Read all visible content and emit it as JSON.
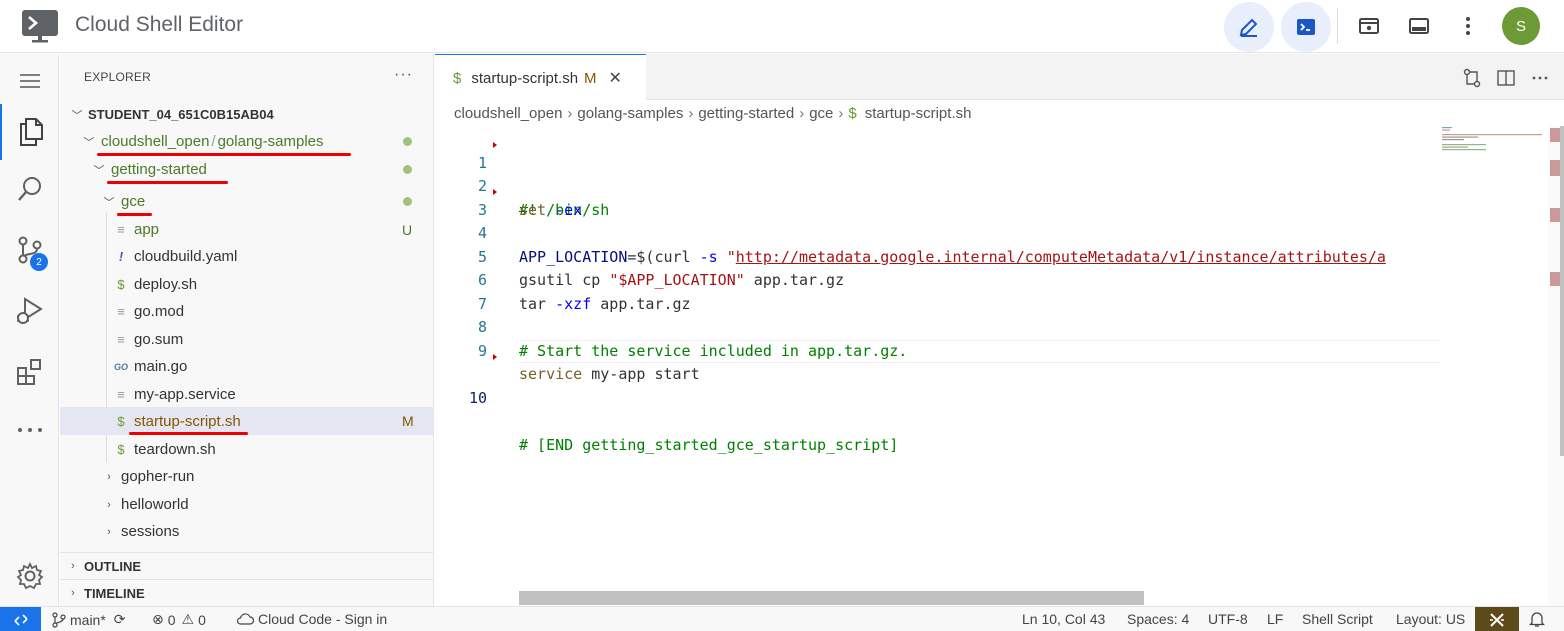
{
  "app": {
    "title": "Cloud Shell Editor",
    "avatar_initial": "S",
    "accent": "#1a73e8"
  },
  "activity": {
    "scm_badge": "2"
  },
  "explorer": {
    "header": "EXPLORER",
    "more": "···",
    "workspace": "STUDENT_04_651C0B15AB04",
    "rows": [
      {
        "label_a": "cloudshell_open",
        "sep": "/",
        "label_b": "golang-samples",
        "status": "dot"
      },
      {
        "label": "getting-started",
        "status": "dot"
      },
      {
        "label": "gce",
        "status": "dot"
      },
      {
        "label": "app",
        "icon": "lines-icon",
        "git": "U"
      },
      {
        "label": "cloudbuild.yaml",
        "icon": "yaml-icon",
        "glyph": "!"
      },
      {
        "label": "deploy.sh",
        "icon": "shell-icon",
        "glyph": "$"
      },
      {
        "label": "go.mod",
        "icon": "lines-icon"
      },
      {
        "label": "go.sum",
        "icon": "lines-icon"
      },
      {
        "label": "main.go",
        "icon": "go-icon",
        "glyph": "GO"
      },
      {
        "label": "my-app.service",
        "icon": "lines-icon"
      },
      {
        "label": "startup-script.sh",
        "icon": "shell-icon",
        "glyph": "$",
        "git": "M"
      },
      {
        "label": "teardown.sh",
        "icon": "shell-icon",
        "glyph": "$"
      },
      {
        "label": "gopher-run"
      },
      {
        "label": "helloworld"
      },
      {
        "label": "sessions"
      }
    ],
    "outline": "OUTLINE",
    "timeline": "TIMELINE"
  },
  "editor": {
    "tab": {
      "label": "startup-script.sh",
      "modified": "M",
      "close": "✕"
    },
    "breadcrumb": [
      "cloudshell_open",
      "golang-samples",
      "getting-started",
      "gce",
      "startup-script.sh"
    ],
    "breadcrumb_sep": "›",
    "line_numbers": [
      "1",
      "2",
      "3",
      "4",
      "5",
      "6",
      "7",
      "8",
      "9",
      "10"
    ],
    "code": {
      "l1": "#! /bin/sh",
      "l2_cmd": "set",
      "l2_flag": " -ex",
      "l4_var": "APP_LOCATION",
      "l4_eq": "=$(curl",
      "l4_flag": " -s ",
      "l4_q": "\"",
      "l4_url": "http://metadata.google.internal/computeMetadata/v1/instance/attributes/a",
      "l5_cmd": "gsutil cp ",
      "l5_str": "\"$APP_LOCATION\"",
      "l5_rest": " app.tar.gz",
      "l6_cmd": "tar",
      "l6_flag": " -xzf",
      "l6_rest": " app.tar.gz",
      "l8": "# Start the service included in app.tar.gz.",
      "l9_cmd": "service",
      "l9_rest": " my-app start",
      "l10": "# [END getting_started_gce_startup_script]"
    }
  },
  "status": {
    "branch": "main*",
    "errors": "0",
    "warnings": "0",
    "cloud_code": "Cloud Code - Sign in",
    "position": "Ln 10, Col 43",
    "spaces": "Spaces: 4",
    "encoding": "UTF-8",
    "eol": "LF",
    "language": "Shell Script",
    "layout": "Layout: US"
  }
}
